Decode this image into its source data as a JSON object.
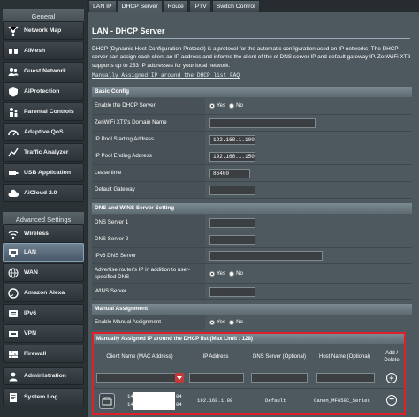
{
  "sidebar": {
    "general_header": "General",
    "advanced_header": "Advanced Settings",
    "items": [
      {
        "label": "Network Map",
        "icon": "network-map-icon"
      },
      {
        "label": "AiMesh",
        "icon": "aimesh-icon"
      },
      {
        "label": "Guest Network",
        "icon": "guest-network-icon"
      },
      {
        "label": "AiProtection",
        "icon": "shield-icon"
      },
      {
        "label": "Parental Controls",
        "icon": "parental-controls-icon"
      },
      {
        "label": "Adaptive QoS",
        "icon": "qos-icon"
      },
      {
        "label": "Traffic Analyzer",
        "icon": "traffic-analyzer-icon"
      },
      {
        "label": "USB Application",
        "icon": "usb-icon"
      },
      {
        "label": "AiCloud 2.0",
        "icon": "cloud-icon"
      },
      {
        "label": "Wireless",
        "icon": "wireless-icon"
      },
      {
        "label": "LAN",
        "icon": "lan-icon"
      },
      {
        "label": "WAN",
        "icon": "globe-icon"
      },
      {
        "label": "Amazon Alexa",
        "icon": "alexa-icon"
      },
      {
        "label": "IPv6",
        "icon": "ipv6-icon"
      },
      {
        "label": "VPN",
        "icon": "vpn-icon"
      },
      {
        "label": "Firewall",
        "icon": "firewall-icon"
      },
      {
        "label": "Administration",
        "icon": "administration-icon"
      },
      {
        "label": "System Log",
        "icon": "system-log-icon"
      }
    ]
  },
  "tabs": [
    "LAN IP",
    "DHCP Server",
    "Route",
    "IPTV",
    "Switch Control"
  ],
  "page": {
    "title": "LAN - DHCP Server",
    "description": "DHCP (Dynamic Host Configuration Protocol) is a protocol for the automatic configuration used on IP networks. The DHCP server can assign each client an IP address and informs the client of the of DNS server IP and default gateway IP. ZenWiFi XT9 supports up to 253 IP addresses for your local network.",
    "faq_link": "Manually Assigned IP around the DHCP list FAQ"
  },
  "basic_config": {
    "header": "Basic Config",
    "enable_label": "Enable the DHCP Server",
    "domain_label": "ZenWiFi XT9's Domain Name",
    "start_label": "IP Pool Starting Address",
    "start_value": "192.168.1.100",
    "end_label": "IP Pool Ending Address",
    "end_value": "192.168.1.150",
    "lease_label": "Lease time",
    "lease_value": "86400",
    "gateway_label": "Default Gateway"
  },
  "radio": {
    "yes": "Yes",
    "no": "No"
  },
  "dns_config": {
    "header": "DNS and WINS Server Setting",
    "dns1_label": "DNS Server 1",
    "dns2_label": "DNS Server 2",
    "ipv6_dns_label": "IPv6 DNS Server",
    "advertise_label": "Advertise router's IP in addition to user-specified DNS",
    "wins_label": "WINS Server"
  },
  "manual": {
    "header": "Manual Assignment",
    "enable_label": "Enable Manual Assignment"
  },
  "table": {
    "header": "Manually Assigned IP around the DHCP list (Max Limit : 128)",
    "col_client": "Client Name (MAC Address)",
    "col_ip": "IP Address",
    "col_dns": "DNS Server (Optional)",
    "col_host": "Host Name (Optional)",
    "col_add": "Add / Delete",
    "row": {
      "mac_prefix_1": "14",
      "mac_prefix_2": "14",
      "mac_suffix_1": "04",
      "mac_suffix_2": "04",
      "ip": "192.168.1.99",
      "dns": "Default",
      "host": "Canon_MF650C_Series"
    }
  }
}
